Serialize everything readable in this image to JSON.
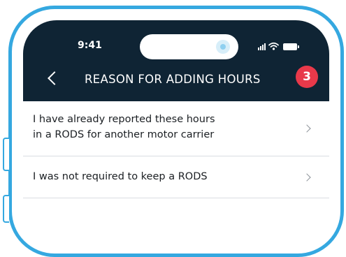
{
  "status_bar": {
    "time": "9:41",
    "icons": [
      "signal-icon",
      "wifi-icon",
      "battery-icon"
    ]
  },
  "header": {
    "back_icon": "chevron-left-icon",
    "title": "REASON FOR ADDING HOURS",
    "step_badge": "3"
  },
  "reasons": [
    {
      "line1": "I have already reported these hours",
      "line2": "in a RODS for another motor carrier"
    },
    {
      "line1": "I was not required to keep a RODS"
    }
  ],
  "colors": {
    "frame": "#35a8e0",
    "header_bg": "#0f2434",
    "badge": "#e8394a",
    "text": "#1b1f23",
    "divider": "#d9dde1"
  }
}
